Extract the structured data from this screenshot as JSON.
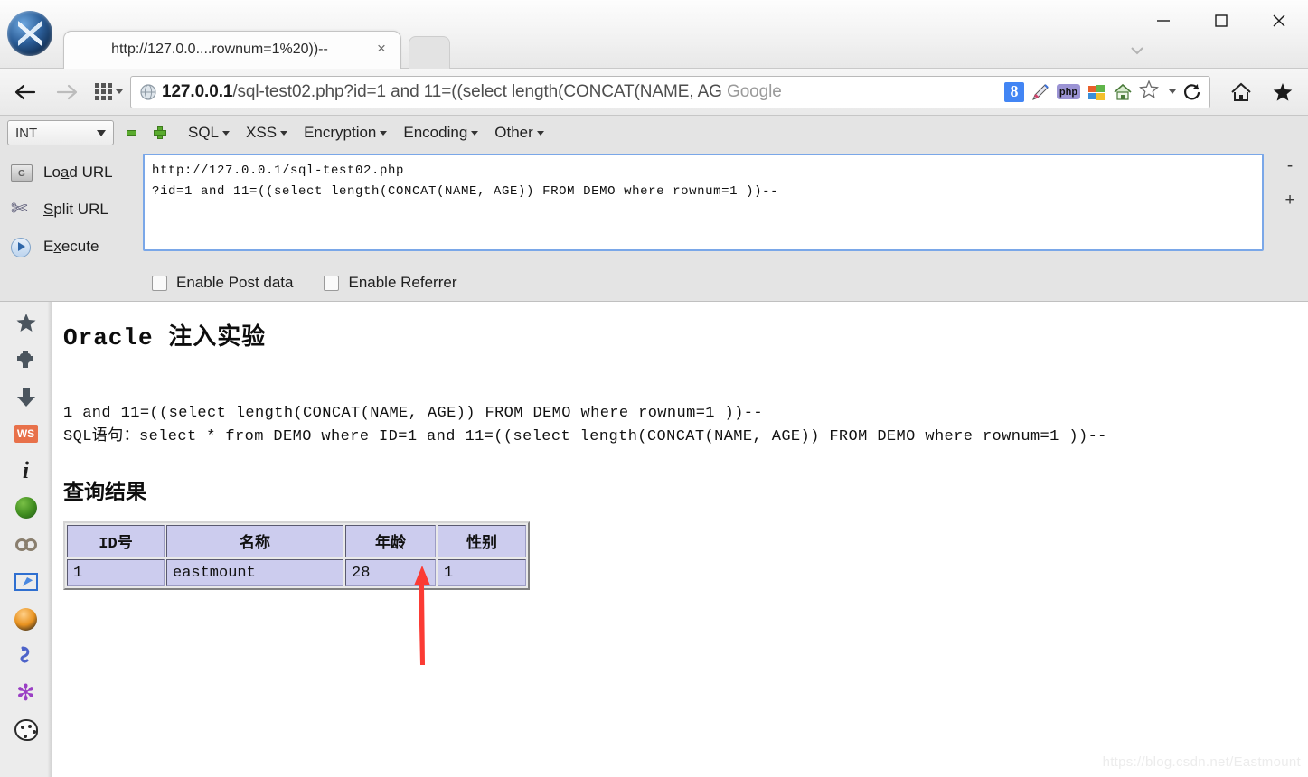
{
  "window": {
    "controls": {
      "minimize": "minimize-icon",
      "maximize": "maximize-icon",
      "close": "close-icon"
    },
    "tab_list_chevron": "chevron-down-icon"
  },
  "tab": {
    "title": "http://127.0.0....rownum=1%20))--",
    "close_label": "×",
    "new_tab_label": ""
  },
  "navigation": {
    "back": "back-arrow-icon",
    "forward": "forward-arrow-icon",
    "apps": "apps-grid-icon",
    "reload": "C",
    "home": "home-icon",
    "bookmark_star": "★"
  },
  "omnibox": {
    "host": "127.0.0.1",
    "path_query": "/sql-test02.php?id=1 and 11=((select length(CONCAT(NAME, AG",
    "search_hint": "Google",
    "icons": [
      "globe-icon",
      "google-icon",
      "pen-icon",
      "php-icon",
      "windows-icon",
      "home-icon",
      "star-icon",
      "dropdown-icon",
      "reload-icon"
    ],
    "google_letter": "8",
    "php_label": "php",
    "reload_label": "C"
  },
  "hackbar": {
    "type_select": {
      "value": "INT"
    },
    "remove_label": "−",
    "add_label": "+",
    "menus": [
      {
        "label": "SQL"
      },
      {
        "label": "XSS"
      },
      {
        "label": "Encryption"
      },
      {
        "label": "Encoding"
      },
      {
        "label": "Other"
      }
    ],
    "buttons": [
      {
        "label_pre": "Lo",
        "accel": "a",
        "label_post": "d URL",
        "icon": "load-url-icon"
      },
      {
        "label_pre": "",
        "accel": "S",
        "label_post": "plit URL",
        "icon": "split-url-icon"
      },
      {
        "label_pre": "E",
        "accel": "x",
        "label_post": "ecute",
        "icon": "execute-icon"
      }
    ],
    "url_textarea": "http://127.0.0.1/sql-test02.php\n?id=1 and 11=((select length(CONCAT(NAME, AGE)) FROM DEMO where rownum=1 ))--",
    "zoom_out": "-",
    "zoom_in": "+",
    "checkboxes": [
      {
        "label": "Enable Post data",
        "checked": false
      },
      {
        "label": "Enable Referrer",
        "checked": false
      }
    ]
  },
  "sidebar": {
    "items": [
      {
        "name": "star-icon",
        "glyph": "★"
      },
      {
        "name": "puzzle-icon",
        "glyph": "❖"
      },
      {
        "name": "download-arrow-icon",
        "glyph": "⬇"
      },
      {
        "name": "ws-badge-icon",
        "glyph": "WS"
      },
      {
        "name": "info-icon",
        "glyph": "i"
      },
      {
        "name": "green-globe-icon",
        "glyph": ""
      },
      {
        "name": "chain-link-icon",
        "glyph": "∞"
      },
      {
        "name": "select-cursor-icon",
        "glyph": ""
      },
      {
        "name": "orange-ball-icon",
        "glyph": ""
      },
      {
        "name": "seahorse-icon",
        "glyph": "દ"
      },
      {
        "name": "purple-burst-icon",
        "glyph": "✻"
      },
      {
        "name": "palette-icon",
        "glyph": ""
      }
    ]
  },
  "page": {
    "title": "Oracle 注入实验",
    "echo_line_1": "1 and 11=((select length(CONCAT(NAME, AGE)) FROM DEMO where rownum=1 ))--",
    "echo_line_2": "SQL语句：select * from DEMO where ID=1 and 11=((select length(CONCAT(NAME, AGE)) FROM DEMO where rownum=1 ))--",
    "results_heading": "查询结果",
    "table": {
      "headers": [
        "ID号",
        "名称",
        "年龄",
        "性别"
      ],
      "rows": [
        [
          "1",
          "eastmount",
          "28",
          "1"
        ]
      ]
    },
    "annotation": "red-up-arrow",
    "watermark": "https://blog.csdn.net/Eastmount"
  },
  "colors": {
    "accent_blue": "#7aa7e8",
    "table_cell": "#ccccee",
    "arrow_red": "#fb3b34",
    "ws_badge": "#e8714a"
  }
}
